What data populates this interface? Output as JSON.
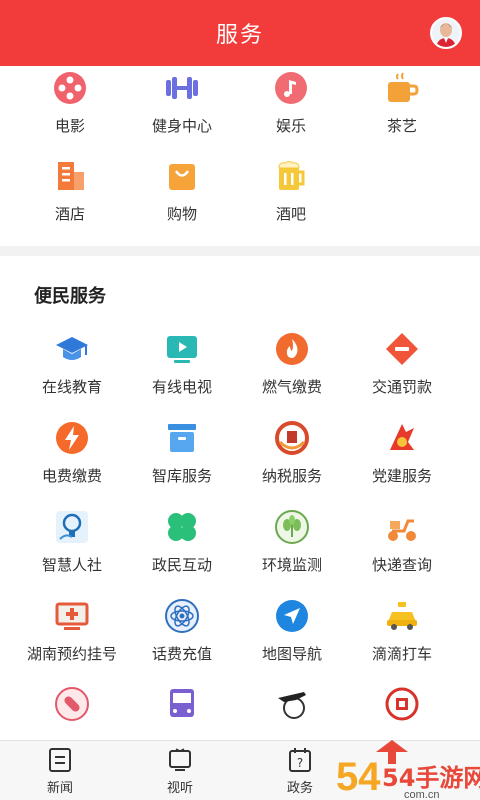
{
  "header": {
    "title": "服务"
  },
  "top_grid": [
    {
      "label": "电影",
      "icon": "film-reel-icon"
    },
    {
      "label": "健身中心",
      "icon": "dumbbell-icon"
    },
    {
      "label": "娱乐",
      "icon": "music-note-icon"
    },
    {
      "label": "茶艺",
      "icon": "tea-cup-icon"
    },
    {
      "label": "酒店",
      "icon": "hotel-building-icon"
    },
    {
      "label": "购物",
      "icon": "shopping-bag-icon"
    },
    {
      "label": "酒吧",
      "icon": "beer-mug-icon"
    }
  ],
  "convenience": {
    "title": "便民服务",
    "items": [
      {
        "label": "在线教育",
        "icon": "graduation-cap-icon"
      },
      {
        "label": "有线电视",
        "icon": "tv-play-icon"
      },
      {
        "label": "燃气缴费",
        "icon": "flame-icon"
      },
      {
        "label": "交通罚款",
        "icon": "no-entry-sign-icon"
      },
      {
        "label": "电费缴费",
        "icon": "lightning-icon"
      },
      {
        "label": "智库服务",
        "icon": "archive-box-icon"
      },
      {
        "label": "纳税服务",
        "icon": "tax-emblem-icon"
      },
      {
        "label": "党建服务",
        "icon": "party-emblem-icon"
      },
      {
        "label": "智慧人社",
        "icon": "idea-bulb-icon"
      },
      {
        "label": "政民互动",
        "icon": "clover-icon"
      },
      {
        "label": "环境监测",
        "icon": "leaf-icon"
      },
      {
        "label": "快递查询",
        "icon": "delivery-scooter-icon"
      },
      {
        "label": "湖南预约挂号",
        "icon": "medical-monitor-icon"
      },
      {
        "label": "话费充值",
        "icon": "atom-icon"
      },
      {
        "label": "地图导航",
        "icon": "navigation-arrow-icon"
      },
      {
        "label": "滴滴打车",
        "icon": "taxi-icon"
      },
      {
        "label": "",
        "icon": "pill-icon"
      },
      {
        "label": "",
        "icon": "bus-icon"
      },
      {
        "label": "",
        "icon": "airplane-globe-icon"
      },
      {
        "label": "",
        "icon": "official-seal-icon"
      }
    ]
  },
  "tabs": [
    {
      "label": "新闻",
      "icon": "news-icon"
    },
    {
      "label": "视听",
      "icon": "tv-icon"
    },
    {
      "label": "政务",
      "icon": "help-calendar-icon"
    }
  ],
  "watermark": {
    "text": "54手游网",
    "subtext": "com.cn"
  },
  "colors": {
    "brand_red": "#f23b3b"
  }
}
